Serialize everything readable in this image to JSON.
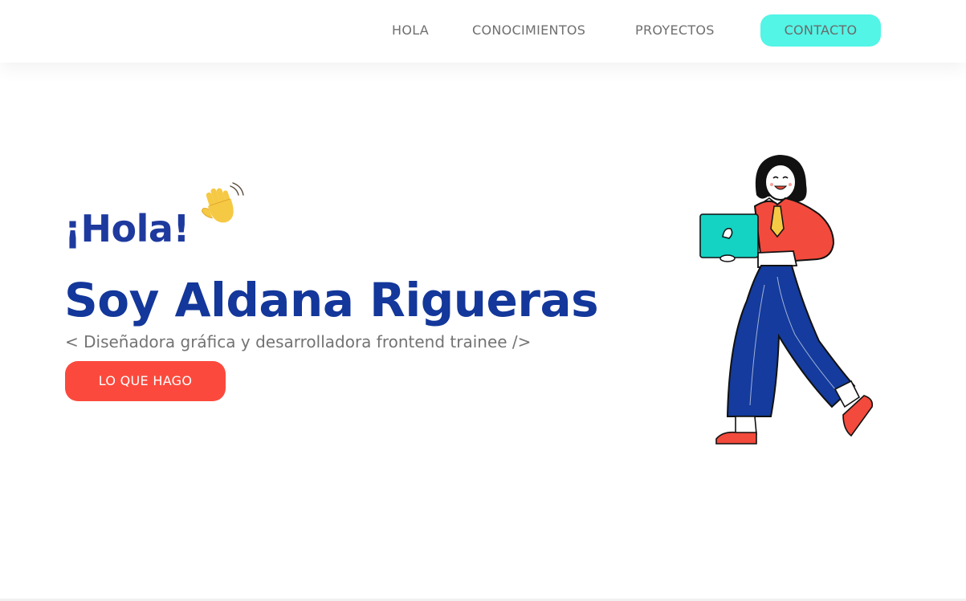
{
  "nav": {
    "items": [
      {
        "label": "HOLA"
      },
      {
        "label": "CONOCIMIENTOS"
      },
      {
        "label": "PROYECTOS"
      }
    ],
    "cta_label": "CONTACTO"
  },
  "hero": {
    "greeting": "¡Hola!",
    "name": "Soy Aldana Rigueras",
    "subtitle": "< Diseñadora gráfica y desarrolladora frontend trainee />",
    "button_label": "LO QUE HAGO"
  },
  "colors": {
    "accent_cyan": "#52f5e6",
    "accent_red": "#fb4a3d",
    "heading_blue": "#13379a"
  }
}
